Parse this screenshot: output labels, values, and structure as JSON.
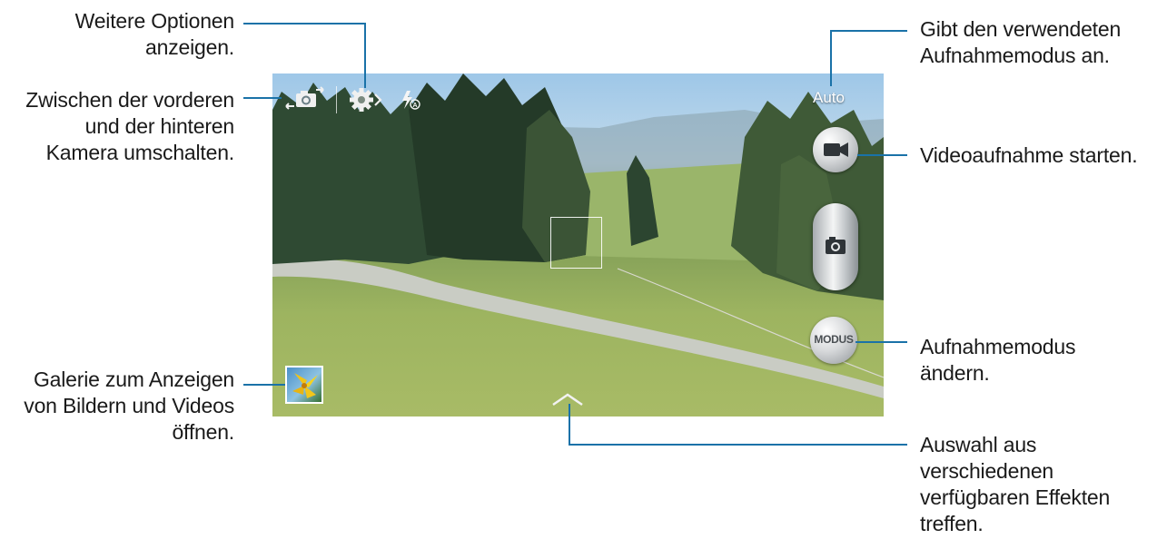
{
  "callouts": {
    "options": [
      "Weitere Optionen",
      "anzeigen."
    ],
    "switch_camera": [
      "Zwischen der vorderen",
      "und der hinteren",
      "Kamera umschalten."
    ],
    "gallery": [
      "Galerie zum Anzeigen",
      "von Bildern und Videos",
      "öffnen."
    ],
    "mode_indicator": [
      "Gibt den verwendeten",
      "Aufnahmemodus an."
    ],
    "video": [
      "Videoaufnahme starten."
    ],
    "change_mode": [
      "Aufnahmemodus",
      "ändern."
    ],
    "effects": [
      "Auswahl aus",
      "verschiedenen",
      "verfügbaren Effekten",
      "treffen."
    ]
  },
  "camera": {
    "mode_text": "Auto",
    "mode_button_label": "MODUS",
    "flash_icon": "flash-auto-icon",
    "settings_icon": "gear-icon",
    "switch_icon": "camera-switch-icon",
    "video_icon": "video-camera-icon",
    "shutter_icon": "camera-icon",
    "effects_icon": "chevron-up-icon"
  },
  "colors": {
    "leader_line": "#1a72a8"
  }
}
